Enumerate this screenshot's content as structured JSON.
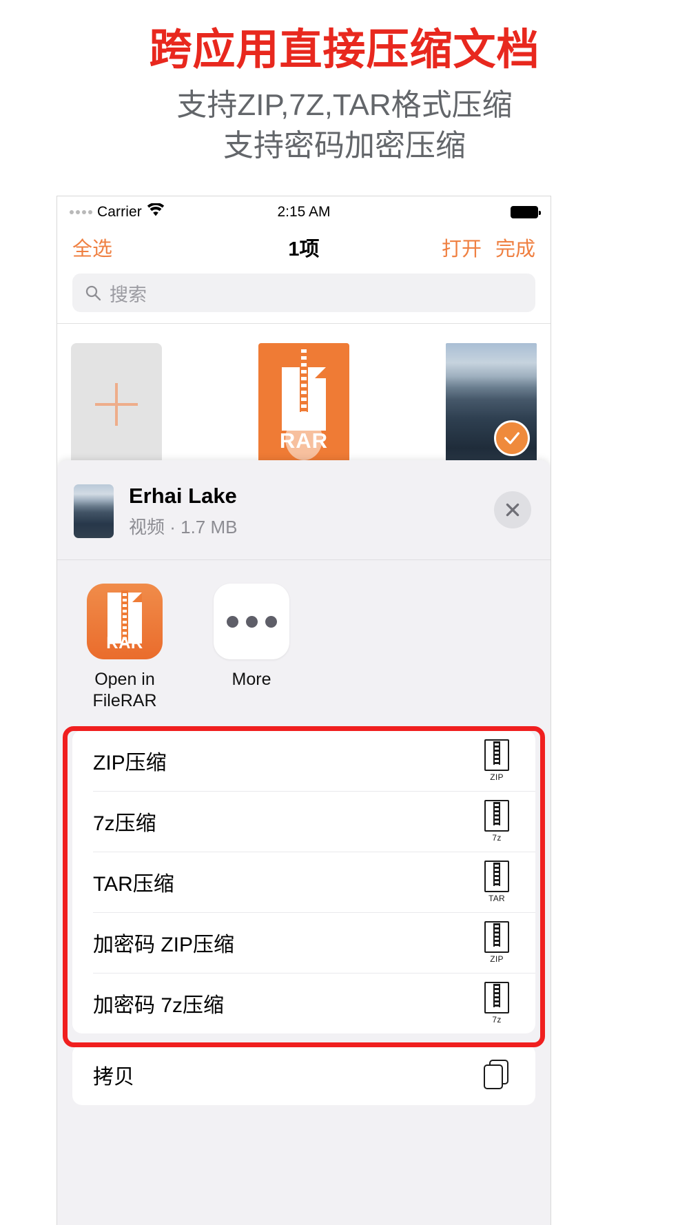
{
  "promo": {
    "title": "跨应用直接压缩文档",
    "subtitle_1": "支持ZIP,7Z,TAR格式压缩",
    "subtitle_2": "支持密码加密压缩",
    "title_color": "#e8281e",
    "subtitle_color": "#63666a"
  },
  "status_bar": {
    "carrier": "Carrier",
    "time": "2:15 AM",
    "wifi_icon": "wifi-icon",
    "battery_icon": "battery-full-icon",
    "signal_icon": "signal-dots-icon"
  },
  "nav": {
    "select_all": "全选",
    "title": "1项",
    "open": "打开",
    "done": "完成",
    "accent_color": "#ef8042"
  },
  "search": {
    "placeholder": "搜索",
    "icon": "search-icon"
  },
  "file_grid": {
    "items": [
      {
        "type": "add",
        "label": "",
        "icon": "plus-icon"
      },
      {
        "type": "archive",
        "label": "RAR",
        "icon": "rar-file-icon"
      },
      {
        "type": "photo",
        "label": "",
        "icon": "photo-thumbnail",
        "selected": true,
        "check_icon": "checkmark-circle-icon"
      }
    ]
  },
  "share_sheet": {
    "file": {
      "name": "Erhai Lake",
      "meta": "视频 · 1.7 MB",
      "thumbnail": "video-thumbnail"
    },
    "close_icon": "close-icon",
    "apps": [
      {
        "label": "Open in\nFileRAR",
        "label_line1": "Open in",
        "label_line2": "FileRAR",
        "icon": "rar-app-icon",
        "badge": "RAR"
      },
      {
        "label": "More",
        "label_line1": "More",
        "label_line2": "",
        "icon": "more-dots-icon"
      }
    ],
    "actions": [
      {
        "label": "ZIP压缩",
        "icon": "zip-file-icon",
        "icon_text": "ZIP",
        "highlighted": true
      },
      {
        "label": "7z压缩",
        "icon": "7z-file-icon",
        "icon_text": "7z",
        "highlighted": true
      },
      {
        "label": "TAR压缩",
        "icon": "tar-file-icon",
        "icon_text": "TAR",
        "highlighted": true
      },
      {
        "label": "加密码 ZIP压缩",
        "icon": "zip-file-icon",
        "icon_text": "ZIP",
        "highlighted": true
      },
      {
        "label": "加密码 7z压缩",
        "icon": "7z-file-icon",
        "icon_text": "7z",
        "highlighted": true
      }
    ],
    "actions_secondary": [
      {
        "label": "拷贝",
        "icon": "copy-icon",
        "icon_text": ""
      }
    ],
    "highlight_color": "#f01f1f"
  }
}
